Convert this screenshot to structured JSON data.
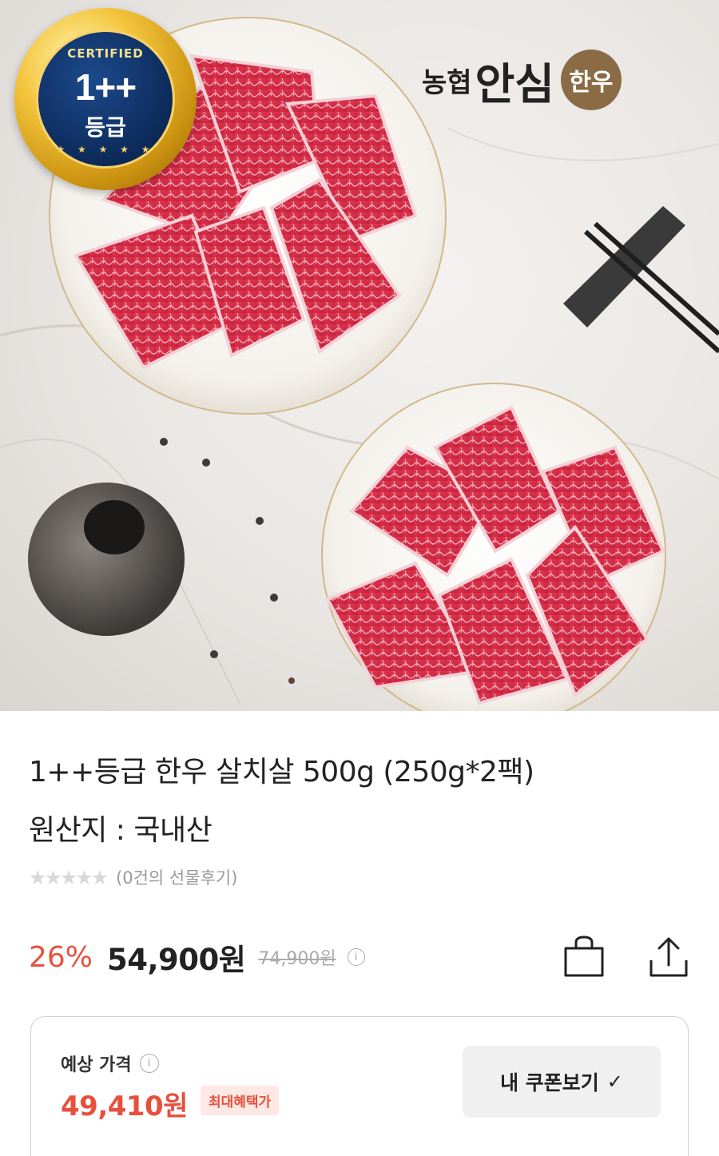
{
  "hero": {
    "badge": {
      "certified": "CERTIFIED",
      "grade": "1++",
      "grade_sub": "등급",
      "stars": "★ ★ ★ ★ ★"
    },
    "brand": {
      "part1": "농협",
      "part2": "안심",
      "part3": "한우"
    }
  },
  "product": {
    "title": "1++등급 한우 살치살 500g (250g*2팩)",
    "origin": "원산지 : 국내산",
    "rating_stars": "★★★★★",
    "review_count": "(0건의 선물후기)"
  },
  "price": {
    "discount": "26%",
    "sale": "54,900원",
    "original": "74,900원",
    "info_glyph": "i"
  },
  "expected": {
    "label": "예상 가격",
    "price": "49,410원",
    "tag": "최대혜택가",
    "coupon_button": "내 쿠폰보기",
    "check_glyph": "✓"
  },
  "colors": {
    "accent": "#e8503d",
    "accent_bg": "#fde8e4",
    "button_bg": "#f0f0f0",
    "brand_brown": "#8b6b45"
  },
  "icons": [
    "shopping-bag-icon",
    "share-icon",
    "info-icon",
    "check-icon"
  ]
}
